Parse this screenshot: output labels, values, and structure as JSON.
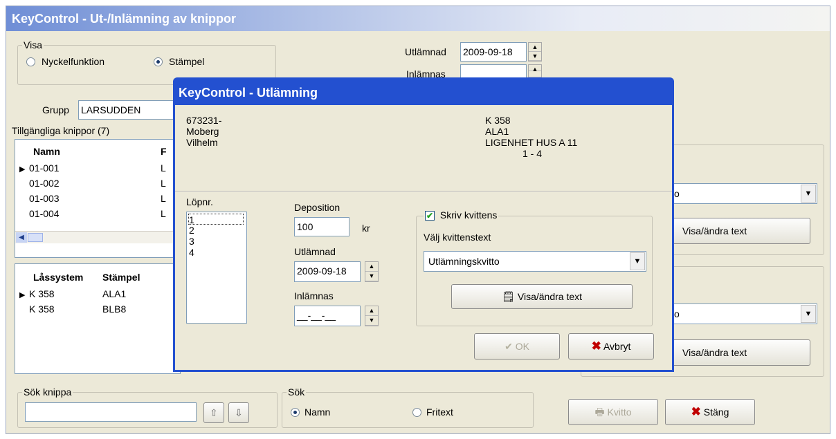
{
  "main_window": {
    "title": "KeyControl - Ut-/Inlämning av knippor",
    "visa": {
      "legend": "Visa",
      "option_nyckelfunktion": "Nyckelfunktion",
      "option_stampel": "Stämpel",
      "selected": "Stämpel"
    },
    "utlamnad_label": "Utlämnad",
    "utlamnad_value": "2009-09-18",
    "inlamnas_label": "Inlämnas",
    "grupp_label": "Grupp",
    "grupp_value": "LARSUDDEN",
    "tillgangliga_label": "Tillgängliga knippor (7)",
    "knippor": {
      "col_namn": "Namn",
      "col_2_partial": "F",
      "rows": [
        {
          "namn": "01-001",
          "col2": "L"
        },
        {
          "namn": "01-002",
          "col2": "L"
        },
        {
          "namn": "01-003",
          "col2": "L"
        },
        {
          "namn": "01-004",
          "col2": "L"
        }
      ]
    },
    "lassystem": {
      "col_lassystem": "Låssystem",
      "col_stampel": "Stämpel",
      "rows": [
        {
          "lassystem": "K 358",
          "stampel": "ALA1"
        },
        {
          "lassystem": "K 358",
          "stampel": "BLB8"
        }
      ]
    },
    "right_panel": {
      "dropdown1_partial": "o",
      "button1": "Visa/ändra text",
      "dropdown2_partial": "o",
      "button2": "Visa/ändra text"
    },
    "sok_knippa": {
      "legend": "Sök knippa",
      "value": "",
      "up_icon": "arrow-up-icon",
      "down_icon": "arrow-down-icon"
    },
    "sok": {
      "legend": "Sök",
      "option_namn": "Namn",
      "option_fritext": "Fritext",
      "selected": "Namn"
    },
    "kvitto_button": "Kvitto",
    "stang_button": "Stäng"
  },
  "dialog": {
    "title": "KeyControl - Utlämning",
    "person": {
      "line1": "673231-",
      "line2": "Moberg",
      "line3": "Vilhelm"
    },
    "key": {
      "line1": "K 358",
      "line2": "ALA1",
      "line3": "LIGENHET HUS A 11",
      "line4": "1 - 4"
    },
    "lopnr_label": "Löpnr.",
    "lopnr_items": [
      "1",
      "2",
      "3",
      "4"
    ],
    "deposition_label": "Deposition",
    "deposition_value": "100",
    "kr_label": "kr",
    "utlamnad_label": "Utlämnad",
    "utlamnad_value": "2009-09-18",
    "inlamnas_label": "Inlämnas",
    "inlamnas_value": "__-__-__",
    "skriv_kvittens_label": "Skriv kvittens",
    "skriv_kvittens_checked": true,
    "valj_label": "Välj kvittenstext",
    "valj_value": "Utlämningskvitto",
    "visa_andra_button": "Visa/ändra text",
    "ok_button": "OK",
    "avbryt_button": "Avbryt"
  },
  "colors": {
    "window_bg": "#ece9d8",
    "dialog_frame": "#2350d0",
    "cancel_x": "#c00000",
    "ok_disabled": "#aca899"
  }
}
